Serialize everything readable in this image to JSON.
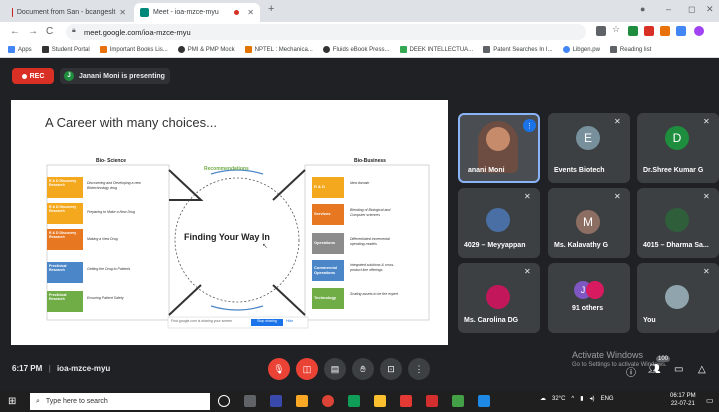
{
  "browser": {
    "tabs": [
      {
        "title": "Document from San - bcangeslt",
        "active": false
      },
      {
        "title": "Meet - ioa-mzce-myu",
        "active": true
      }
    ],
    "new_tab": "+",
    "url": "meet.google.com/ioa-mzce-myu",
    "bookmarks": [
      "Apps",
      "Student Portal",
      "Important Books Lis...",
      "PMI & PMP Mock",
      "NPTEL : Mechanica...",
      "Fluids eBook Press...",
      "DEEK INTELLECTUA...",
      "Patent Searches In I...",
      "Libgen.pw",
      "Reading list"
    ]
  },
  "meet": {
    "rec_label": "REC",
    "presenter_initial": "J",
    "presenting_text": "Janani Moni is presenting",
    "time": "6:17 PM",
    "meeting_code": "ioa-mzce-myu",
    "participants": [
      {
        "name": "anani Moni",
        "initial": "",
        "color": "#5f6368",
        "type": "photo"
      },
      {
        "name": "Events Biotech",
        "initial": "E",
        "color": "#78909c",
        "type": "letter"
      },
      {
        "name": "Dr.Shree Kumar G",
        "initial": "D",
        "color": "#1e8e3e",
        "type": "letter"
      },
      {
        "name": "4029 – Meyyappan",
        "initial": "",
        "color": "#4a6fa5",
        "type": "photo"
      },
      {
        "name": "Ms. Kalavathy G",
        "initial": "M",
        "color": "#8d6e63",
        "type": "letter"
      },
      {
        "name": "4015 – Dharma Sa...",
        "initial": "",
        "color": "#2e5e3a",
        "type": "photo"
      },
      {
        "name": "Ms. Carolina DG",
        "initial": "",
        "color": "#c2185b",
        "type": "photo"
      },
      {
        "name": "91 others",
        "initial": "J",
        "color": "#7e57c2",
        "type": "group"
      },
      {
        "name": "You",
        "initial": "",
        "color": "#90a4ae",
        "type": "photo"
      }
    ],
    "participant_count": "100"
  },
  "slide": {
    "title": "A Career with many choices...",
    "left_header": "Bio- Science",
    "right_header": "Bio-Business",
    "center_header": "Recommendations",
    "center_text": "Finding Your Way In",
    "left_items": [
      {
        "label": "R & D Discovery Research",
        "text": "Discovering and Developing a new Biotechnology drug",
        "color": "#f4a81d"
      },
      {
        "label": "R & D Discovery Research",
        "text": "Preparing to Make a New Drug",
        "color": "#f4a81d"
      },
      {
        "label": "R & D Discovery Research",
        "text": "Making a New Drug",
        "color": "#e87722"
      },
      {
        "label": "Preclinical Research",
        "text": "Getting the Drug to Patients",
        "color": "#4a86c8"
      },
      {
        "label": "Preclinical Research",
        "text": "Ensuring Patient Safety",
        "color": "#70ad47"
      }
    ],
    "right_items": [
      {
        "label": "R & D",
        "text": "Idea domain",
        "color": "#f4a81d"
      },
      {
        "label": "Services",
        "text": "Blending of Biological and Computer sciences",
        "color": "#e87722"
      },
      {
        "label": "Operations",
        "text": "Differentiated incremental operating models",
        "color": "#8c8c8c"
      },
      {
        "label": "Commercial Operations",
        "text": "Integrated solutions & cross-product line offerings",
        "color": "#4a86c8"
      },
      {
        "label": "Technology",
        "text": "Scaling assets to be the expert",
        "color": "#70ad47"
      }
    ],
    "search_placeholder": "Find google.com is sharing your screen",
    "stop_button": "Stop sharing",
    "hide_button": "Hide"
  },
  "windows": {
    "activate_title": "Activate Windows",
    "activate_sub": "Go to Settings to activate Windows.",
    "search_placeholder": "Type here to search",
    "weather": "32°C",
    "lang": "ENG",
    "clock_time": "06:17 PM",
    "clock_date": "22-07-21"
  }
}
